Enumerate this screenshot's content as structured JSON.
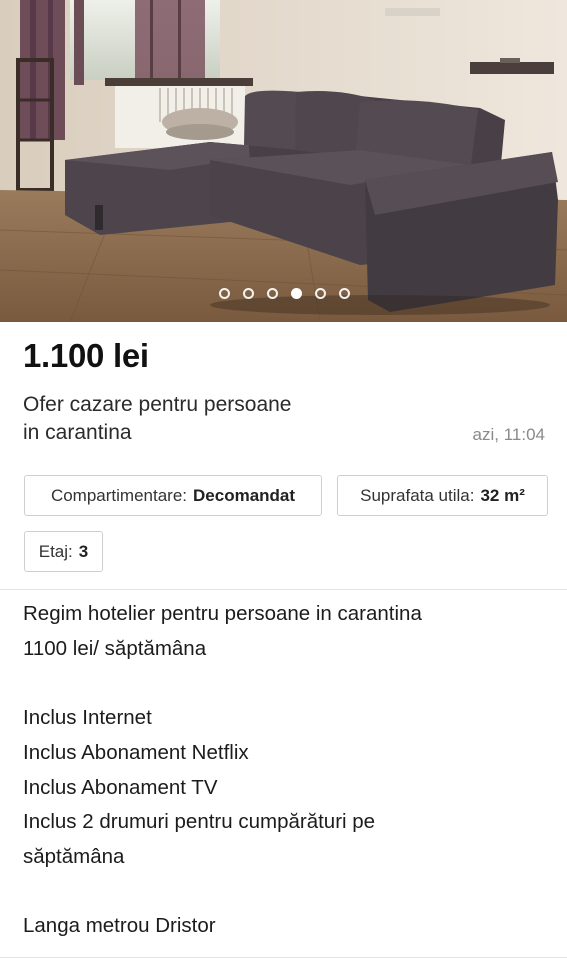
{
  "gallery": {
    "photo_label": "listing-photo-living-room-sofa",
    "dot_count": 6,
    "active_index": 3
  },
  "listing": {
    "price": "1.100 lei",
    "title_line1": "Ofer cazare pentru persoane",
    "title_line2": "in carantina",
    "posted": "azi, 11:04"
  },
  "attributes": [
    {
      "label": "Compartimentare:",
      "value": "Decomandat"
    },
    {
      "label": "Suprafata utila:",
      "value": "32 m²"
    },
    {
      "label": "Etaj:",
      "value": "3"
    }
  ],
  "description": [
    "Regim hotelier pentru persoane in carantina",
    "1100 lei/ săptămâna",
    "",
    "Inclus Internet",
    "Inclus Abonament Netflix",
    "Inclus Abonament TV",
    "Inclus 2 drumuri pentru cumpărături pe",
    "săptămâna",
    "",
    "Langa metrou Dristor"
  ],
  "colors": {
    "sofa": "#4a4249",
    "floor": "#8a6a4c",
    "wall": "#e7ddd0"
  }
}
